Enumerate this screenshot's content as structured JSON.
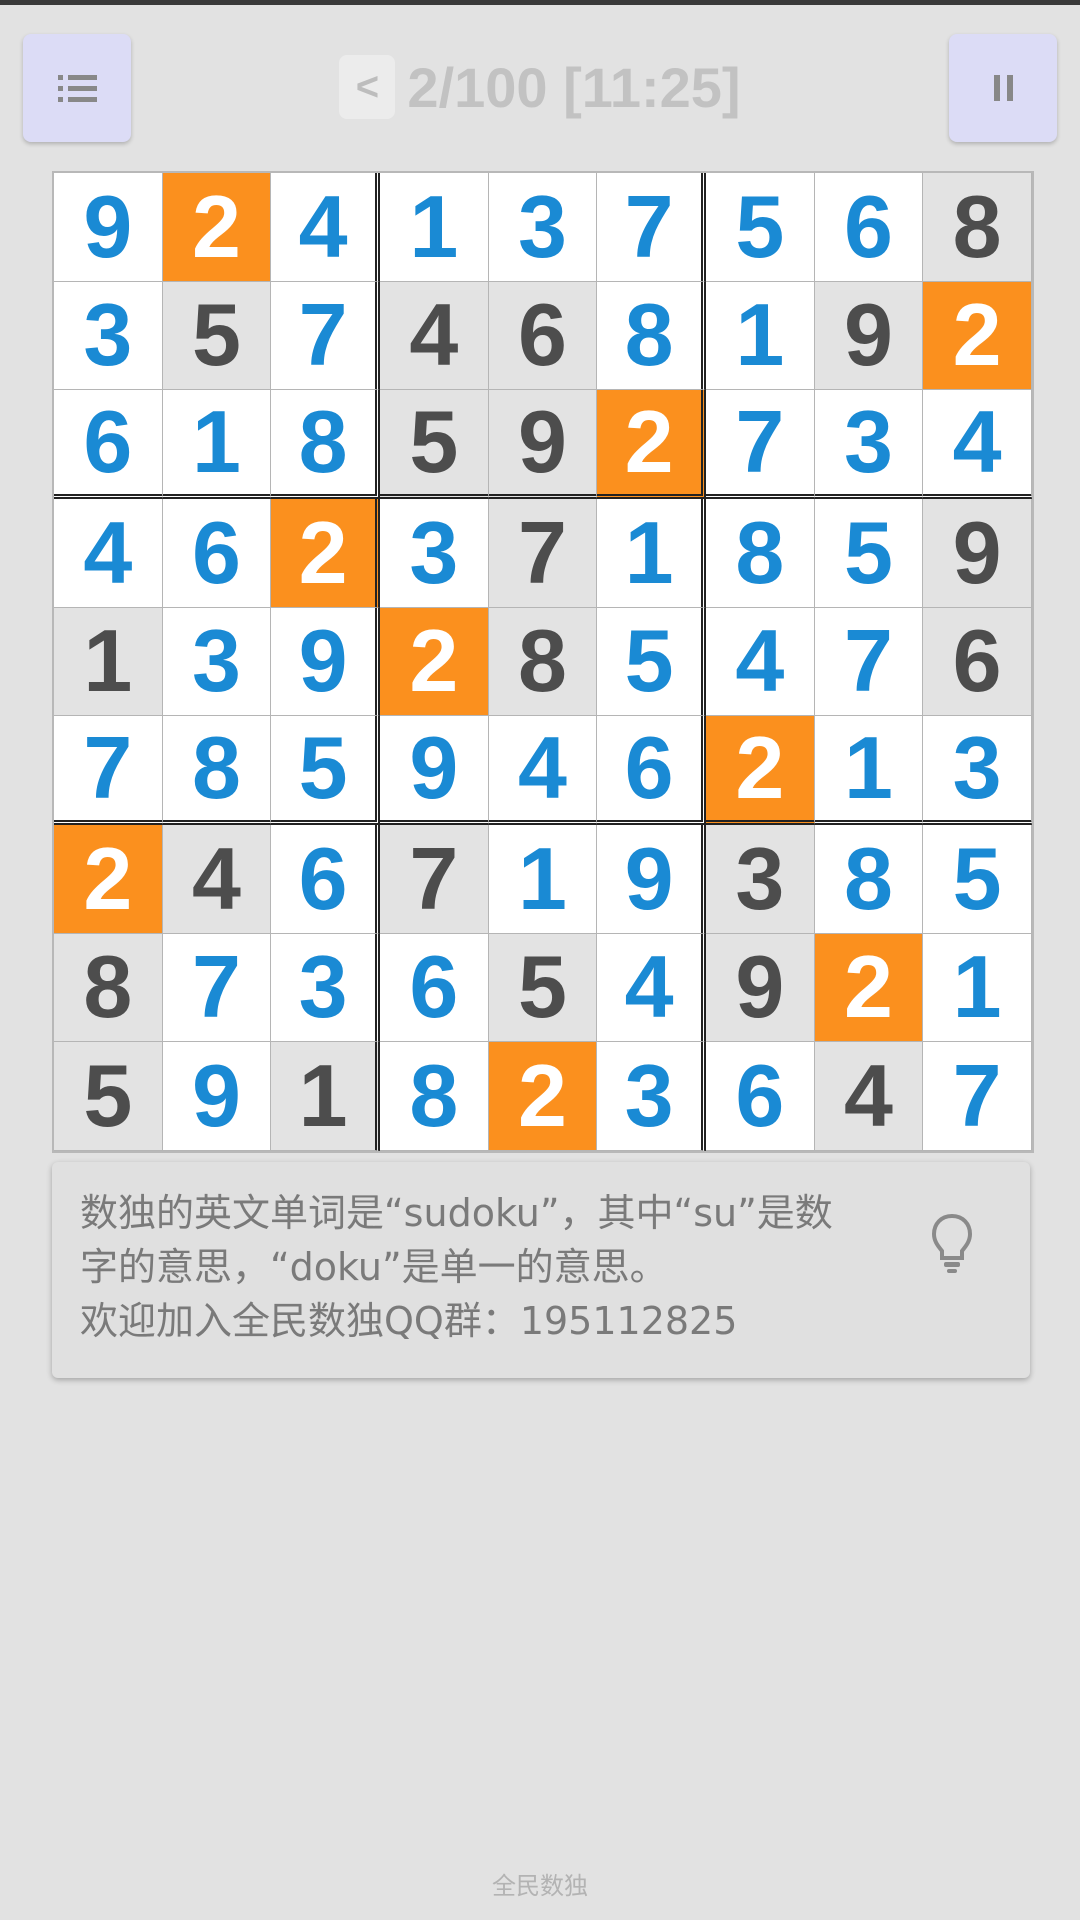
{
  "header": {
    "back_label": "<",
    "title": "2/100 [11:25]"
  },
  "board": {
    "values": [
      [
        9,
        2,
        4,
        1,
        3,
        7,
        5,
        6,
        8
      ],
      [
        3,
        5,
        7,
        4,
        6,
        8,
        1,
        9,
        2
      ],
      [
        6,
        1,
        8,
        5,
        9,
        2,
        7,
        3,
        4
      ],
      [
        4,
        6,
        2,
        3,
        7,
        1,
        8,
        5,
        9
      ],
      [
        1,
        3,
        9,
        2,
        8,
        5,
        4,
        7,
        6
      ],
      [
        7,
        8,
        5,
        9,
        4,
        6,
        2,
        1,
        3
      ],
      [
        2,
        4,
        6,
        7,
        1,
        9,
        3,
        8,
        5
      ],
      [
        8,
        7,
        3,
        6,
        5,
        4,
        9,
        2,
        1
      ],
      [
        5,
        9,
        1,
        8,
        2,
        3,
        6,
        4,
        7
      ]
    ],
    "given": [
      [
        0,
        0,
        0,
        0,
        0,
        0,
        0,
        0,
        1
      ],
      [
        0,
        1,
        0,
        1,
        1,
        0,
        0,
        1,
        0
      ],
      [
        0,
        0,
        0,
        1,
        1,
        0,
        0,
        0,
        0
      ],
      [
        0,
        0,
        0,
        0,
        1,
        0,
        0,
        0,
        1
      ],
      [
        1,
        0,
        0,
        0,
        1,
        0,
        0,
        0,
        1
      ],
      [
        0,
        0,
        0,
        0,
        0,
        0,
        0,
        0,
        0
      ],
      [
        0,
        1,
        0,
        1,
        0,
        0,
        1,
        0,
        0
      ],
      [
        1,
        0,
        0,
        0,
        1,
        0,
        1,
        0,
        0
      ],
      [
        1,
        0,
        1,
        0,
        0,
        0,
        0,
        1,
        0
      ]
    ],
    "highlighted_digit": 2,
    "colors": {
      "user_digit": "#1a8ad4",
      "given_digit": "#4d4d4d",
      "highlight_bg": "#fb901e",
      "given_bg": "#e3e3e3",
      "empty_bg": "#ffffff"
    }
  },
  "hint": {
    "lines": [
      "数独的英文单词是“sudoku”，其中“su”是数",
      "字的意思，“doku”是单一的意思。",
      "欢迎加入全民数独QQ群：195112825"
    ],
    "icon": "lightbulb-icon"
  },
  "footer": {
    "text": "全民数独"
  }
}
